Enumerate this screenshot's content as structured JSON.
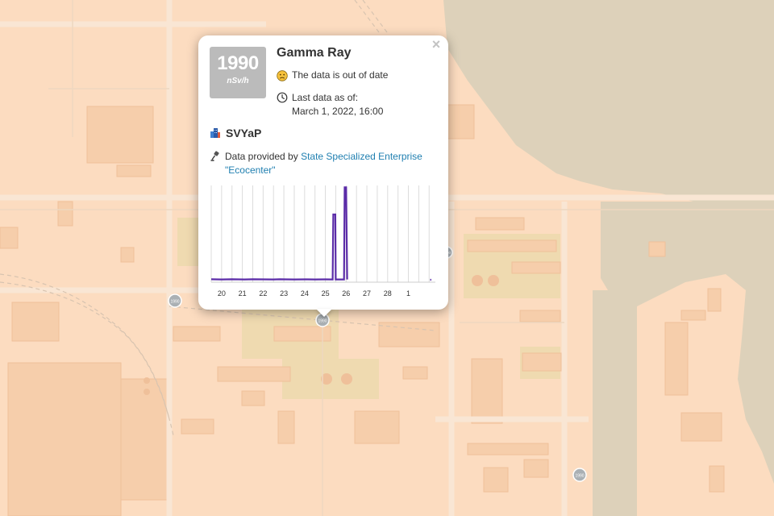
{
  "map": {
    "water_color": "#ddd1ba",
    "land_color": "#fcdcc0",
    "green_color": "#e8d7a8",
    "building_color": "#f6ceab",
    "markers": [
      {
        "name": "map-marker-1",
        "label": "1990"
      },
      {
        "name": "map-marker-2",
        "label": "1990"
      },
      {
        "name": "map-marker-3",
        "label": "1990"
      },
      {
        "name": "map-marker-4",
        "label": "1990"
      }
    ]
  },
  "popup": {
    "close_label": "×",
    "reading": {
      "value": "1990",
      "unit": "nSv/h"
    },
    "title": "Gamma Ray",
    "status_icon": "sad-face-icon",
    "status_text": "The data is out of date",
    "time_icon": "clock-icon",
    "last_data_label": "Last data as of:",
    "last_data_value": "March 1, 2022, 16:00",
    "network_icon": "building-icon",
    "network_name": "SVYaP",
    "provider_icon": "microphone-icon",
    "provider_prefix": "Data provided by",
    "provider_link": "State Specialized Enterprise \"Ecocenter\"",
    "accent_color": "#1f7fb0",
    "badge_color": "#bbbbbb"
  },
  "chart_data": {
    "type": "line",
    "categories": [
      "20",
      "21",
      "22",
      "23",
      "24",
      "25",
      "26",
      "27",
      "28",
      "1"
    ],
    "series": [
      {
        "color": "#5b2ca8",
        "x": [
          19.0,
          19.5,
          20.0,
          20.3,
          20.6,
          21.0,
          21.5,
          22.0,
          22.3,
          22.6,
          23.0,
          23.5,
          24.0,
          24.5,
          24.85,
          24.88,
          24.98,
          25.0,
          25.4,
          25.43,
          25.5,
          25.55,
          25.6,
          28.0,
          29.5,
          29.55,
          29.6
        ],
        "y": [
          30,
          28,
          30,
          29,
          28,
          30,
          29,
          28,
          30,
          29,
          28,
          29,
          28,
          29,
          28,
          700,
          700,
          28,
          28,
          980,
          980,
          28,
          null,
          null,
          null,
          25,
          25
        ]
      }
    ],
    "xlim": [
      19.0,
      29.8
    ],
    "ylim": [
      0,
      1000
    ],
    "grid": true,
    "legend": "none"
  }
}
